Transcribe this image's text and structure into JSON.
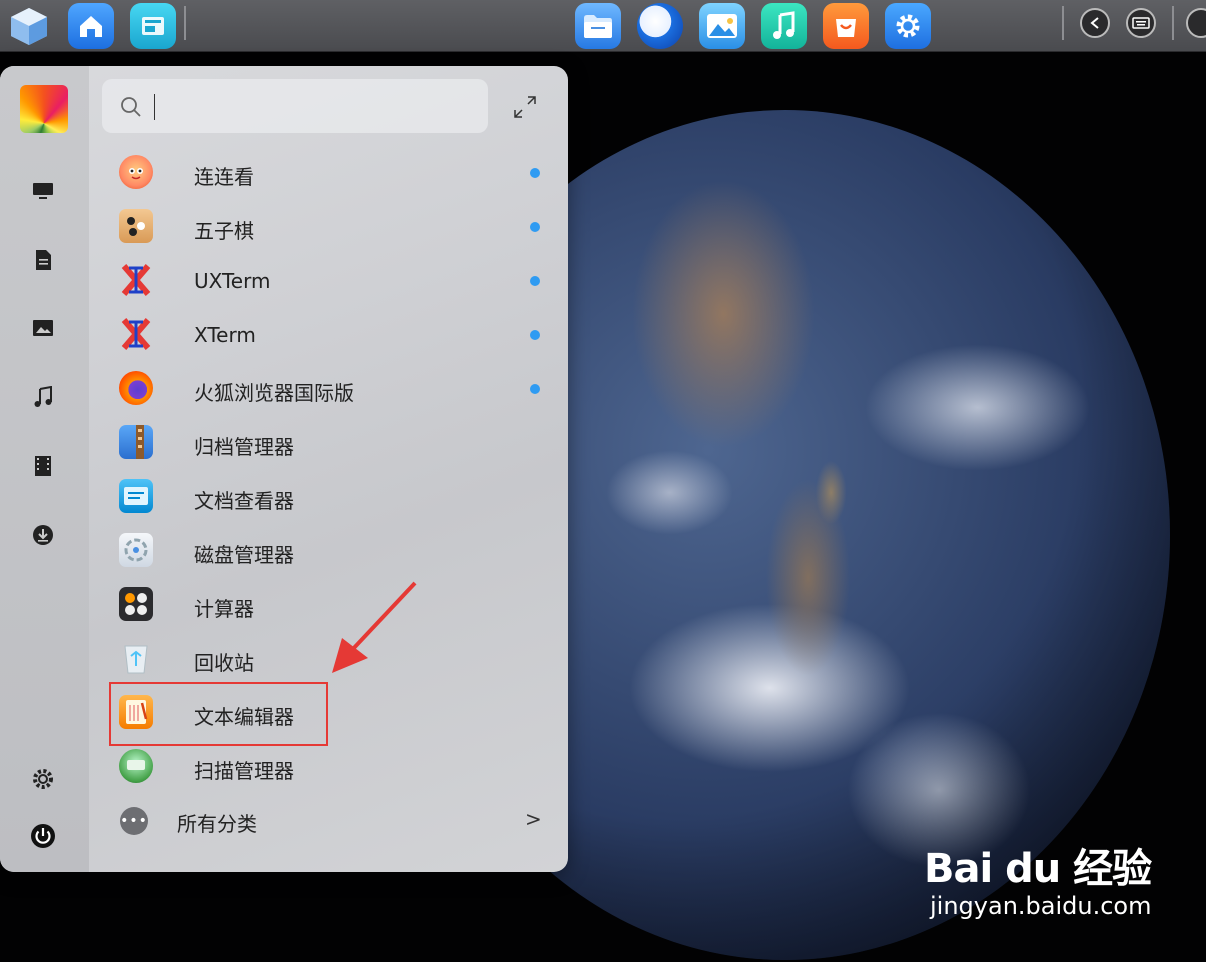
{
  "apps": [
    {
      "label": "连连看",
      "icon": "lianliankan-icon",
      "new": true
    },
    {
      "label": "五子棋",
      "icon": "gomoku-icon",
      "new": true
    },
    {
      "label": "UXTerm",
      "icon": "xterm-icon",
      "new": true
    },
    {
      "label": "XTerm",
      "icon": "xterm-icon",
      "new": true
    },
    {
      "label": "火狐浏览器国际版",
      "icon": "firefox-icon",
      "new": true
    },
    {
      "label": "归档管理器",
      "icon": "archive-manager-icon",
      "new": false
    },
    {
      "label": "文档查看器",
      "icon": "document-viewer-icon",
      "new": false
    },
    {
      "label": "磁盘管理器",
      "icon": "disk-manager-icon",
      "new": false
    },
    {
      "label": "计算器",
      "icon": "calculator-icon",
      "new": false
    },
    {
      "label": "回收站",
      "icon": "trash-icon",
      "new": false
    },
    {
      "label": "文本编辑器",
      "icon": "text-editor-icon",
      "new": false
    },
    {
      "label": "扫描管理器",
      "icon": "scanner-icon",
      "new": false
    }
  ],
  "all_categories": {
    "label": "所有分类",
    "chevron": ">"
  },
  "search": {
    "placeholder": ""
  },
  "watermark": {
    "brand": "Bai du 经验",
    "url": "jingyan.baidu.com"
  },
  "colors": {
    "new_dot": "#2f9bf2",
    "highlight": "#e53935",
    "arrow": "#e53935"
  }
}
